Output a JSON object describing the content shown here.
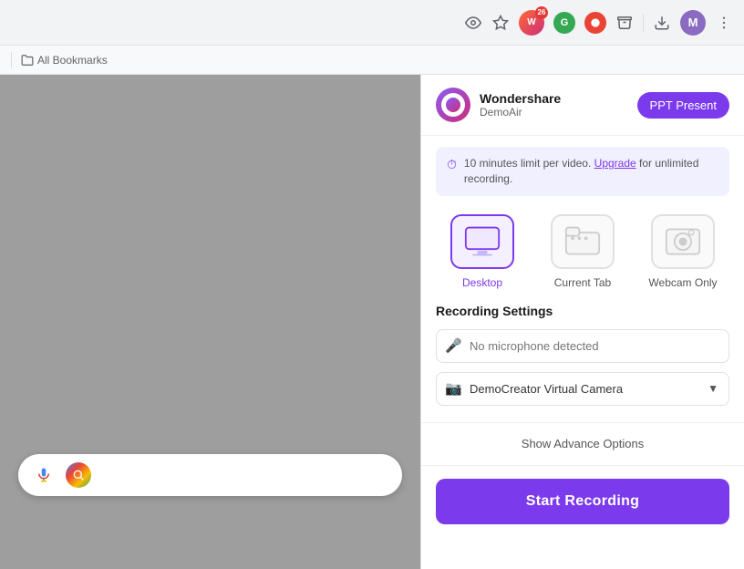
{
  "browser": {
    "bookmarks_label": "All Bookmarks"
  },
  "header": {
    "brand_name": "Wondershare",
    "brand_subtitle": "DemoAir",
    "ppt_button": "PPT Present"
  },
  "limit_notice": {
    "text": "10 minutes limit per video.",
    "upgrade_text": "Upgrade",
    "suffix_text": " for unlimited recording."
  },
  "modes": [
    {
      "id": "desktop",
      "label": "Desktop",
      "active": true
    },
    {
      "id": "current-tab",
      "label": "Current Tab",
      "active": false
    },
    {
      "id": "webcam-only",
      "label": "Webcam Only",
      "active": false
    }
  ],
  "settings": {
    "title": "Recording Settings",
    "microphone_placeholder": "No microphone detected",
    "camera_value": "DemoCreator Virtual Camera"
  },
  "advance_options_label": "Show Advance Options",
  "start_recording_label": "Start Recording"
}
